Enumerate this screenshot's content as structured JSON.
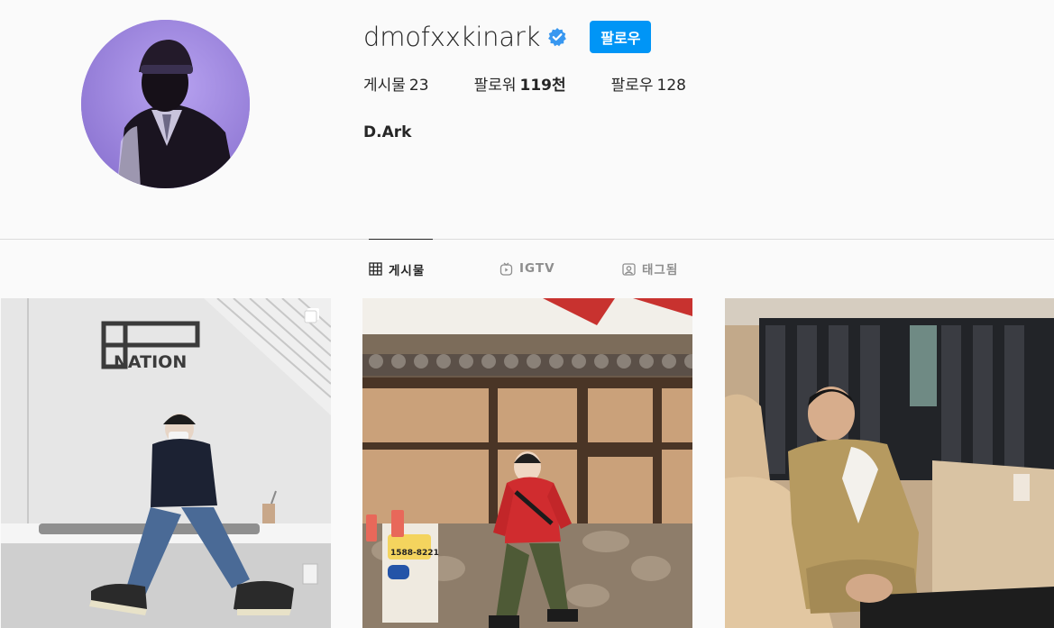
{
  "profile": {
    "username": "dmofxxkinark",
    "follow_label": "팔로우",
    "full_name": "D.Ark",
    "verified_icon": "verified-badge-icon",
    "accent_color": "#0095f6"
  },
  "stats": {
    "posts_label": "게시물",
    "posts_value": "23",
    "followers_label": "팔로워",
    "followers_value": "119천",
    "following_label": "팔로우",
    "following_value": "128"
  },
  "tabs": [
    {
      "label": "게시물",
      "icon": "grid-icon",
      "active": true
    },
    {
      "label": "IGTV",
      "icon": "igtv-icon",
      "active": false
    },
    {
      "label": "태그됨",
      "icon": "tagged-icon",
      "active": false
    }
  ],
  "posts": [
    {
      "sign_text": "NATION",
      "multi_image": true
    },
    {
      "sign_text": "1588-8221",
      "multi_image": false
    },
    {
      "sign_text": "",
      "multi_image": false
    }
  ]
}
